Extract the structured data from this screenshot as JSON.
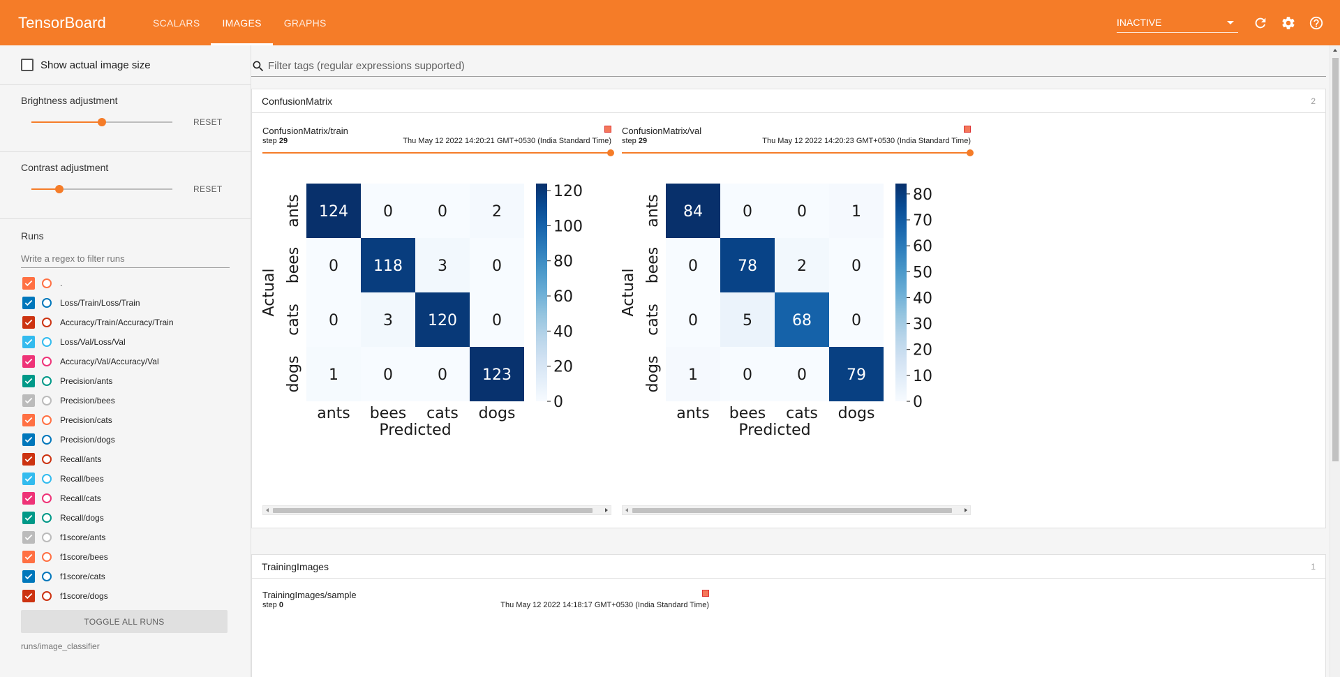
{
  "header": {
    "brand": "TensorBoard",
    "tabs": [
      {
        "label": "SCALARS",
        "active": false
      },
      {
        "label": "IMAGES",
        "active": true
      },
      {
        "label": "GRAPHS",
        "active": false
      }
    ],
    "run_selector": "INACTIVE",
    "icons": [
      "refresh-icon",
      "settings-icon",
      "help-icon"
    ]
  },
  "sidebar": {
    "show_actual_size_label": "Show actual image size",
    "brightness_label": "Brightness adjustment",
    "brightness_value": 0.5,
    "contrast_label": "Contrast adjustment",
    "contrast_value": 0.2,
    "reset_label": "RESET",
    "runs_title": "Runs",
    "runs_filter_placeholder": "Write a regex to filter runs",
    "runs": [
      {
        "name": ".",
        "color": "#ff7043"
      },
      {
        "name": "Loss/Train/Loss/Train",
        "color": "#0077bb"
      },
      {
        "name": "Accuracy/Train/Accuracy/Train",
        "color": "#cc3311"
      },
      {
        "name": "Loss/Val/Loss/Val",
        "color": "#33bbee"
      },
      {
        "name": "Accuracy/Val/Accuracy/Val",
        "color": "#ee3377"
      },
      {
        "name": "Precision/ants",
        "color": "#009988"
      },
      {
        "name": "Precision/bees",
        "color": "#bbbbbb"
      },
      {
        "name": "Precision/cats",
        "color": "#ff7043"
      },
      {
        "name": "Precision/dogs",
        "color": "#0077bb"
      },
      {
        "name": "Recall/ants",
        "color": "#cc3311"
      },
      {
        "name": "Recall/bees",
        "color": "#33bbee"
      },
      {
        "name": "Recall/cats",
        "color": "#ee3377"
      },
      {
        "name": "Recall/dogs",
        "color": "#009988"
      },
      {
        "name": "f1score/ants",
        "color": "#bbbbbb"
      },
      {
        "name": "f1score/bees",
        "color": "#ff7043"
      },
      {
        "name": "f1score/cats",
        "color": "#0077bb"
      },
      {
        "name": "f1score/dogs",
        "color": "#cc3311"
      }
    ],
    "toggle_all_label": "TOGGLE ALL RUNS",
    "data_location": "runs/image_classifier"
  },
  "main": {
    "filter_placeholder": "Filter tags (regular expressions supported)",
    "panes": [
      {
        "title": "ConfusionMatrix",
        "count": "2",
        "cards": [
          {
            "tag": "ConfusionMatrix/train",
            "step_label": "step",
            "step": "29",
            "time": "Thu May 12 2022 14:20:21 GMT+0530 (India Standard Time)"
          },
          {
            "tag": "ConfusionMatrix/val",
            "step_label": "step",
            "step": "29",
            "time": "Thu May 12 2022 14:20:23 GMT+0530 (India Standard Time)"
          }
        ]
      },
      {
        "title": "TrainingImages",
        "count": "1",
        "cards": [
          {
            "tag": "TrainingImages/sample",
            "step_label": "step",
            "step": "0",
            "time": "Thu May 12 2022 14:18:17 GMT+0530 (India Standard Time)"
          }
        ]
      }
    ]
  },
  "chart_data": [
    {
      "type": "heatmap",
      "title": "",
      "xlabel": "Predicted",
      "ylabel": "Actual",
      "x_categories": [
        "ants",
        "bees",
        "cats",
        "dogs"
      ],
      "y_categories": [
        "ants",
        "bees",
        "cats",
        "dogs"
      ],
      "values": [
        [
          124,
          0,
          0,
          2
        ],
        [
          0,
          118,
          3,
          0
        ],
        [
          0,
          3,
          120,
          0
        ],
        [
          1,
          0,
          0,
          123
        ]
      ],
      "colorbar_ticks": [
        0,
        20,
        40,
        60,
        80,
        100,
        120
      ],
      "vmax": 124,
      "colormap": "Blues"
    },
    {
      "type": "heatmap",
      "title": "",
      "xlabel": "Predicted",
      "ylabel": "Actual",
      "x_categories": [
        "ants",
        "bees",
        "cats",
        "dogs"
      ],
      "y_categories": [
        "ants",
        "bees",
        "cats",
        "dogs"
      ],
      "values": [
        [
          84,
          0,
          0,
          1
        ],
        [
          0,
          78,
          2,
          0
        ],
        [
          0,
          5,
          68,
          0
        ],
        [
          1,
          0,
          0,
          79
        ]
      ],
      "colorbar_ticks": [
        0,
        10,
        20,
        30,
        40,
        50,
        60,
        70,
        80
      ],
      "vmax": 84,
      "colormap": "Blues"
    }
  ]
}
